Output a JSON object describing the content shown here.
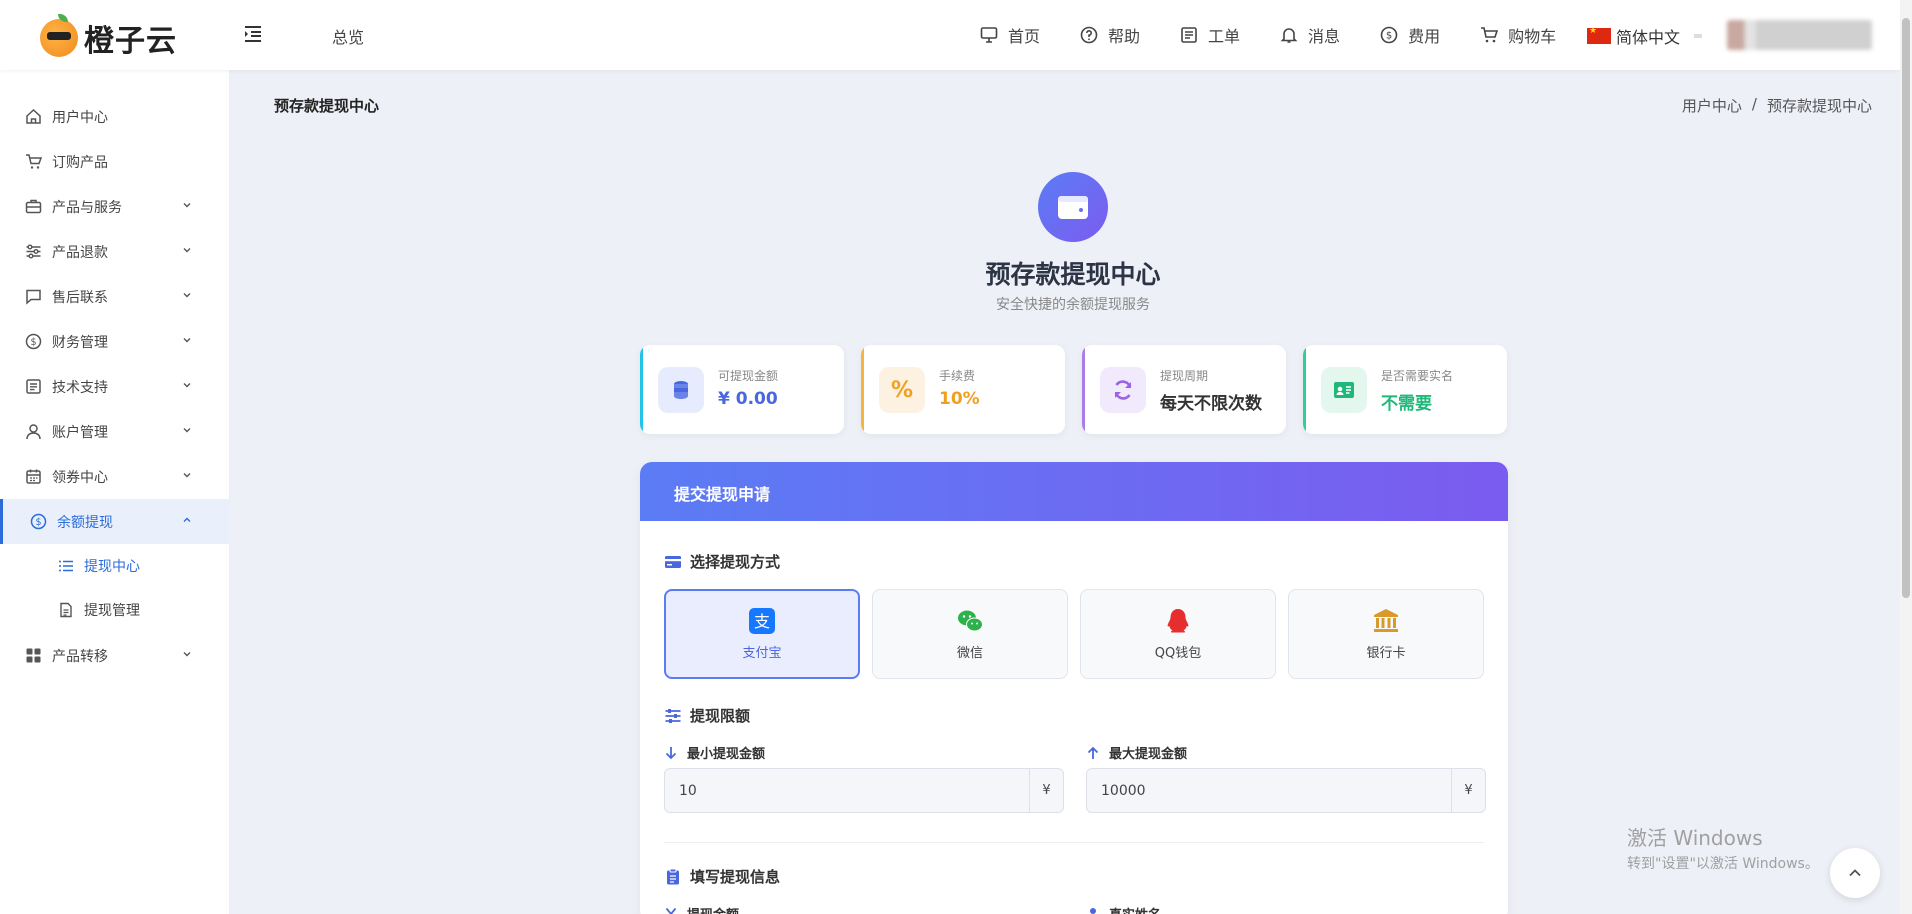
{
  "header": {
    "logo_text": "橙子云",
    "overview": "总览",
    "nav": [
      {
        "label": "首页",
        "icon": "monitor-icon"
      },
      {
        "label": "帮助",
        "icon": "help-icon"
      },
      {
        "label": "工单",
        "icon": "ticket-icon"
      },
      {
        "label": "消息",
        "icon": "bell-icon"
      },
      {
        "label": "费用",
        "icon": "dollar-icon"
      },
      {
        "label": "购物车",
        "icon": "cart-icon"
      }
    ],
    "language": "简体中文"
  },
  "sidebar": {
    "items": [
      {
        "label": "用户中心"
      },
      {
        "label": "订购产品"
      },
      {
        "label": "产品与服务"
      },
      {
        "label": "产品退款"
      },
      {
        "label": "售后联系"
      },
      {
        "label": "财务管理"
      },
      {
        "label": "技术支持"
      },
      {
        "label": "账户管理"
      },
      {
        "label": "领券中心"
      },
      {
        "label": "余额提现"
      },
      {
        "label": "产品转移"
      }
    ],
    "subitems": [
      {
        "label": "提现中心"
      },
      {
        "label": "提现管理"
      }
    ]
  },
  "page": {
    "heading": "预存款提现中心",
    "breadcrumb": [
      "用户中心",
      "/",
      "预存款提现中心"
    ]
  },
  "hero": {
    "title": "预存款提现中心",
    "subtitle": "安全快捷的余额提现服务"
  },
  "stats": [
    {
      "label": "可提现金额",
      "value": "¥ 0.00",
      "color": "#4a67e0",
      "accent": "#22c3e6"
    },
    {
      "label": "手续费",
      "value": "10%",
      "color": "#f0a020",
      "accent": "#f5b53d"
    },
    {
      "label": "提现周期",
      "value": "每天不限次数",
      "color": "#333333",
      "accent": "#a97de8"
    },
    {
      "label": "是否需要实名",
      "value": "不需要",
      "color": "#1fb87a",
      "accent": "#2ed193"
    }
  ],
  "form": {
    "panel_title": "提交提现申请",
    "method_section": "选择提现方式",
    "methods": [
      {
        "label": "支付宝",
        "icon": "alipay-icon",
        "selected": true
      },
      {
        "label": "微信",
        "icon": "wechat-icon",
        "selected": false
      },
      {
        "label": "QQ钱包",
        "icon": "qq-icon",
        "selected": false
      },
      {
        "label": "银行卡",
        "icon": "bank-icon",
        "selected": false
      }
    ],
    "limit_section": "提现限额",
    "min_label": "最小提现金额",
    "min_value": "10",
    "max_label": "最大提现金额",
    "max_value": "10000",
    "currency": "¥",
    "fill_section": "填写提现信息",
    "amount_label": "提现金额",
    "name_label": "真实姓名"
  },
  "watermark": {
    "line1": "激活 Windows",
    "line2": "转到\"设置\"以激活 Windows。"
  }
}
